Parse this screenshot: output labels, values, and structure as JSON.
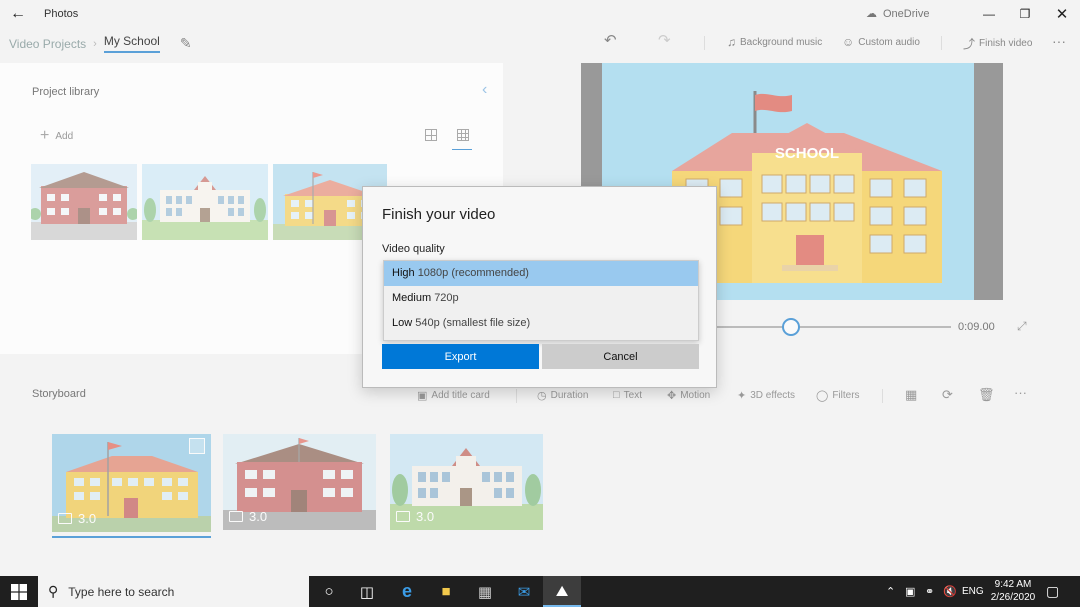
{
  "app": {
    "title": "Photos",
    "onedrive_label": "OneDrive"
  },
  "breadcrumb": {
    "parent": "Video Projects",
    "current": "My School"
  },
  "toolbar": {
    "background_music": "Background music",
    "custom_audio": "Custom audio",
    "finish_video": "Finish video"
  },
  "library": {
    "title": "Project library",
    "add_label": "Add"
  },
  "preview": {
    "sign_text": "SCHOOL",
    "time": "0:09.00",
    "scrub_position_fraction": 0.32
  },
  "storyboard": {
    "title": "Storyboard",
    "tools": {
      "add_title_card": "Add title card",
      "duration": "Duration",
      "text": "Text",
      "motion": "Motion",
      "effects_3d": "3D effects",
      "filters": "Filters"
    },
    "clips": [
      {
        "duration": "3.0"
      },
      {
        "duration": "3.0"
      },
      {
        "duration": "3.0"
      }
    ]
  },
  "dialog": {
    "title": "Finish your video",
    "quality_label": "Video quality",
    "options": [
      {
        "name": "High",
        "detail": "1080p (recommended)"
      },
      {
        "name": "Medium",
        "detail": "720p"
      },
      {
        "name": "Low",
        "detail": "540p (smallest file size)"
      }
    ],
    "export_label": "Export",
    "cancel_label": "Cancel"
  },
  "taskbar": {
    "search_placeholder": "Type here to search",
    "language": "ENG",
    "time": "9:42 AM",
    "date": "2/26/2020"
  },
  "colors": {
    "accent": "#0078d7",
    "selection": "#99c9ef",
    "sky": "#b4dff0"
  }
}
